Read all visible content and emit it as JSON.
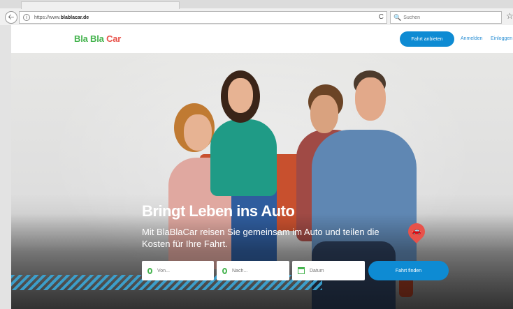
{
  "browser": {
    "url_prefix": "https://www.",
    "url_domain": "blablacar.de",
    "search_placeholder": "Suchen",
    "reload_glyph": "C",
    "icons": [
      "back-icon",
      "info-icon",
      "reload-icon",
      "search-icon",
      "star-icon"
    ]
  },
  "header": {
    "logo_bla": "Bla Bla",
    "logo_car": "Car",
    "offer_button": "Fahrt anbieten",
    "login_link": "Anmelden",
    "signup_link": "Einloggen"
  },
  "hero": {
    "title": "Bringt Leben ins Auto",
    "subtitle": "Mit BlaBlaCar reisen Sie gemeinsam im Auto und teilen die Kosten für Ihre Fahrt.",
    "from_placeholder": "Von...",
    "to_placeholder": "Nach...",
    "date_placeholder": "Datum",
    "find_button": "Fahrt finden"
  },
  "colors": {
    "brand_green": "#46b44f",
    "brand_red": "#e8524a",
    "brand_blue": "#0e8bd3"
  }
}
